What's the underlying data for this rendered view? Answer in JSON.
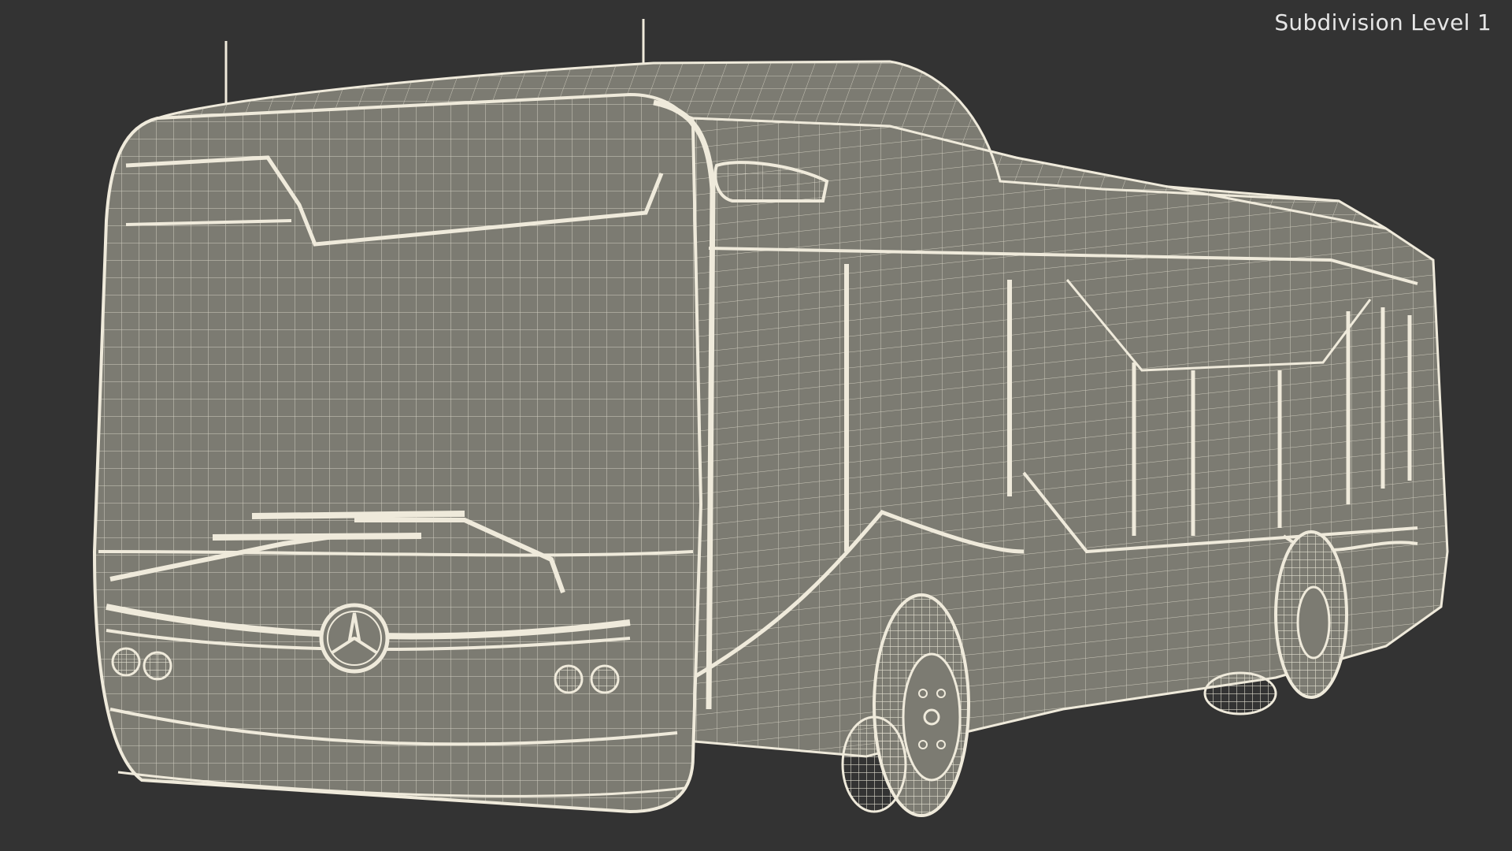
{
  "viewport": {
    "subdivision_label": "Subdivision Level 1"
  },
  "model": {
    "subject": "city bus wireframe",
    "wire_color": "#efeadb",
    "shell_color": "#7c7b72",
    "background_color": "#333333"
  }
}
